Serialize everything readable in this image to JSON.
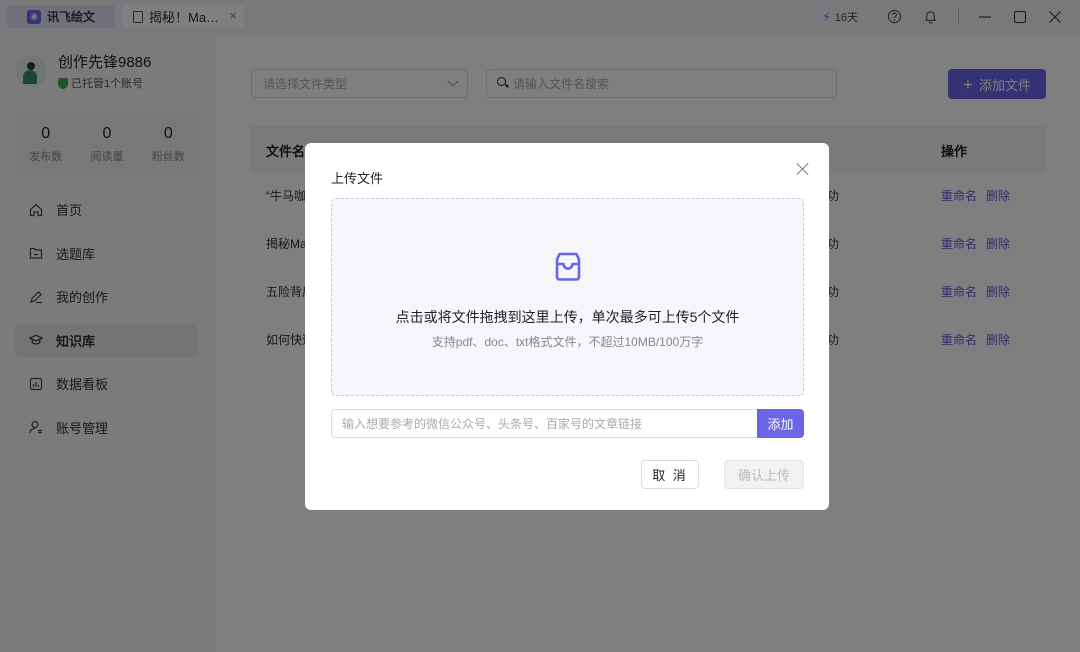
{
  "titlebar": {
    "app_name": "讯飞绘文",
    "doc_tab": "揭秘！Ma…",
    "tab_close": "×",
    "days": "16天"
  },
  "user": {
    "name": "创作先锋9886",
    "sub": "已托管1个账号"
  },
  "stats": [
    {
      "value": "0",
      "label": "发布数"
    },
    {
      "value": "0",
      "label": "阅读量"
    },
    {
      "value": "0",
      "label": "粉丝数"
    }
  ],
  "nav": [
    {
      "label": "首页",
      "icon": "home-icon"
    },
    {
      "label": "选题库",
      "icon": "folder-icon"
    },
    {
      "label": "我的创作",
      "icon": "pen-icon"
    },
    {
      "label": "知识库",
      "icon": "graduation-cap-icon",
      "active": true
    },
    {
      "label": "数据看板",
      "icon": "chart-icon"
    },
    {
      "label": "账号管理",
      "icon": "user-icon"
    }
  ],
  "toolbar": {
    "file_type_placeholder": "请选择文件类型",
    "search_placeholder": "请输入文件名搜索",
    "add_file": "添加文件"
  },
  "table": {
    "headers": {
      "name": "文件名",
      "actions": "操作"
    },
    "rows": [
      {
        "name": "“牛马咖",
        "status": "功",
        "rename": "重命名",
        "delete": "删除"
      },
      {
        "name": "揭秘Ma",
        "status": "功",
        "rename": "重命名",
        "delete": "删除"
      },
      {
        "name": "五险背后",
        "status": "功",
        "rename": "重命名",
        "delete": "删除"
      },
      {
        "name": "如何快速",
        "status": "功",
        "rename": "重命名",
        "delete": "删除"
      }
    ]
  },
  "dialog": {
    "title": "上传文件",
    "drop_main": "点击或将文件拖拽到这里上传，单次最多可上传5个文件",
    "drop_sub": "支持pdf、doc、txt格式文件，不超过10MB/100万字",
    "link_placeholder": "输入想要参考的微信公众号、头条号、百家号的文章链接",
    "link_add": "添加",
    "cancel": "取 消",
    "confirm": "确认上传"
  },
  "colors": {
    "accent": "#6b66e8",
    "link": "#5b56e0"
  }
}
